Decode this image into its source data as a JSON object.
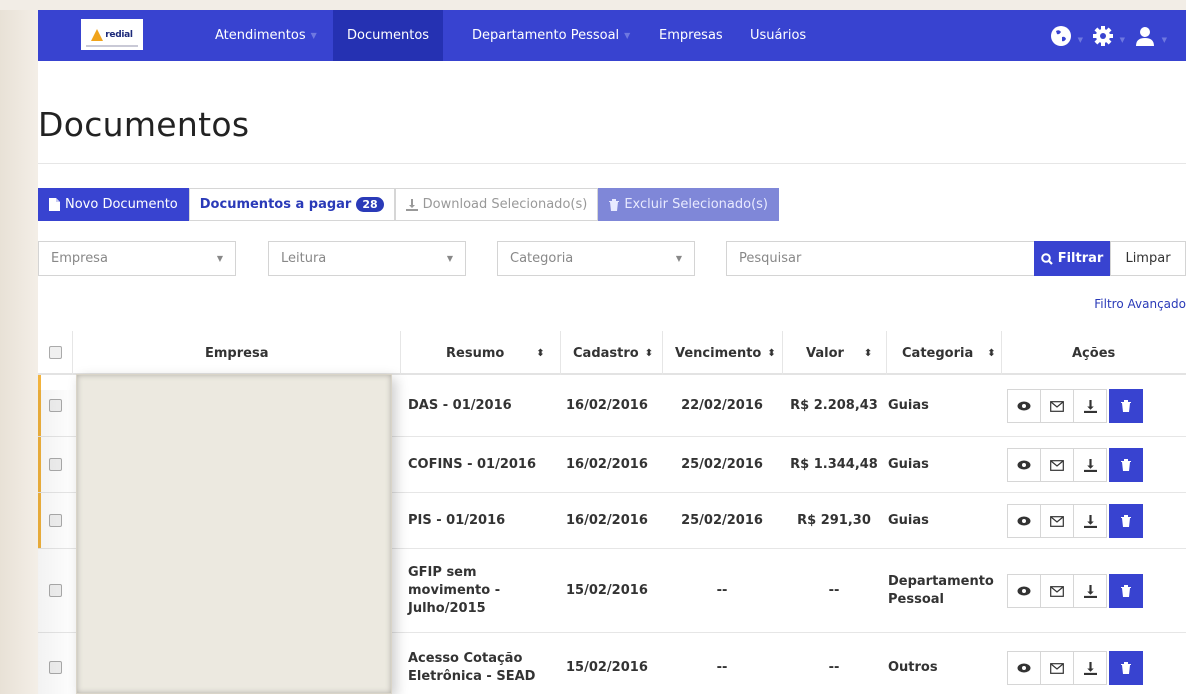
{
  "logo": {
    "text": "redial"
  },
  "nav": {
    "items": [
      {
        "label": "Atendimentos",
        "has_caret": true
      },
      {
        "label": "Documentos",
        "has_caret": false,
        "active": true
      },
      {
        "label": "Departamento Pessoal",
        "has_caret": true
      },
      {
        "label": "Empresas",
        "has_caret": false
      },
      {
        "label": "Usuários",
        "has_caret": false
      }
    ],
    "icons": [
      "globe-icon",
      "gear-icon",
      "user-icon"
    ]
  },
  "page": {
    "title": "Documentos"
  },
  "toolbar": {
    "new_label": "Novo Documento",
    "pay_label": "Documentos a pagar",
    "pay_count": "28",
    "download_label": "Download Selecionado(s)",
    "delete_label": "Excluir Selecionado(s)"
  },
  "filters": {
    "empresa_placeholder": "Empresa",
    "leitura_placeholder": "Leitura",
    "categoria_placeholder": "Categoria",
    "search_placeholder": "Pesquisar",
    "filter_label": "Filtrar",
    "clear_label": "Limpar",
    "advanced_label": "Filtro Avançado"
  },
  "table": {
    "headers": {
      "empresa": "Empresa",
      "resumo": "Resumo",
      "cadastro": "Cadastro",
      "vencimento": "Vencimento",
      "valor": "Valor",
      "categoria": "Categoria",
      "acoes": "Ações"
    },
    "rows": [
      {
        "resumo": [
          "DAS - 01/2016"
        ],
        "cadastro": "16/02/2016",
        "vencimento": "22/02/2016",
        "valor": "R$ 2.208,43",
        "categoria": [
          "Guias"
        ],
        "highlight": true
      },
      {
        "resumo": [
          "COFINS - 01/2016"
        ],
        "cadastro": "16/02/2016",
        "vencimento": "25/02/2016",
        "valor": "R$ 1.344,48",
        "categoria": [
          "Guias"
        ],
        "highlight": true
      },
      {
        "resumo": [
          "PIS - 01/2016"
        ],
        "cadastro": "16/02/2016",
        "vencimento": "25/02/2016",
        "valor": "R$ 291,30",
        "categoria": [
          "Guias"
        ],
        "highlight": true
      },
      {
        "resumo": [
          "GFIP sem",
          "movimento -",
          "Julho/2015"
        ],
        "cadastro": "15/02/2016",
        "vencimento": "--",
        "valor": "--",
        "categoria": [
          "Departamento",
          "Pessoal"
        ],
        "highlight": false
      },
      {
        "resumo": [
          "Acesso Cotação",
          "Eletrônica - SEAD"
        ],
        "cadastro": "15/02/2016",
        "vencimento": "--",
        "valor": "--",
        "categoria": [
          "Outros"
        ],
        "highlight": false
      }
    ]
  },
  "colors": {
    "primary": "#3843d0",
    "active_nav": "#2531b2",
    "accent": "#f2b33d"
  }
}
